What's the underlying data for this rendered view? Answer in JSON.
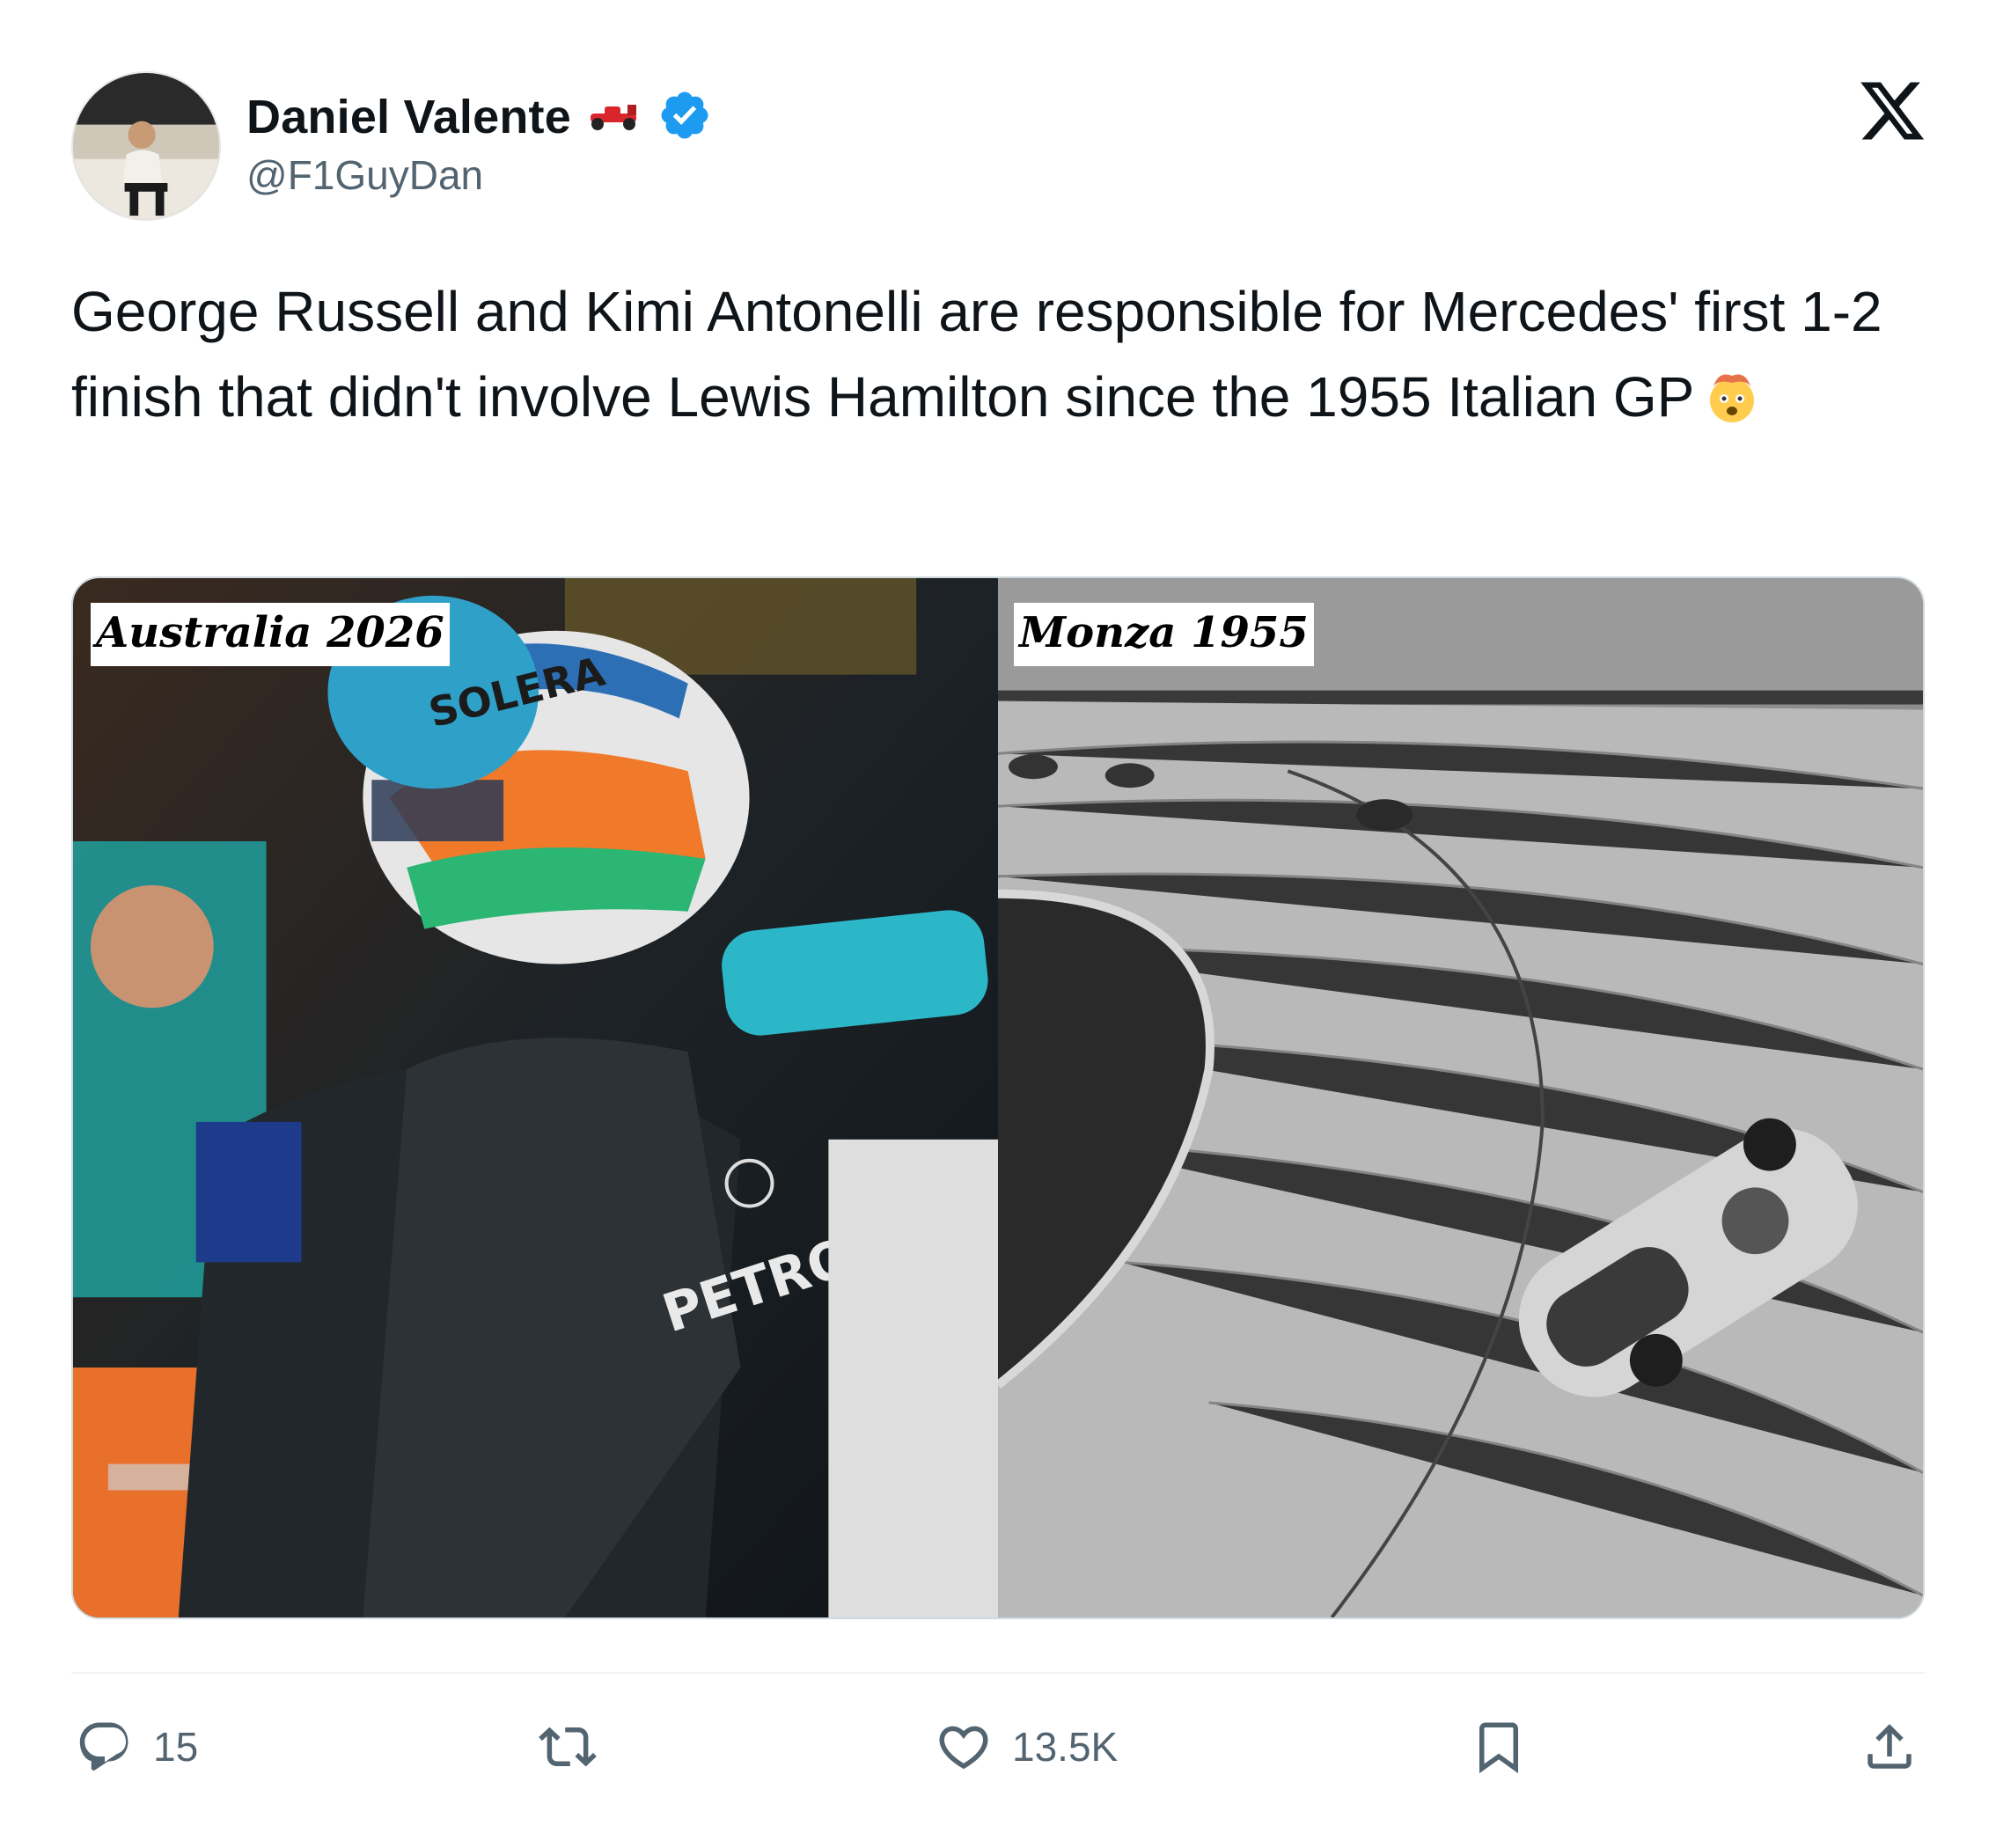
{
  "author": {
    "display_name": "Daniel Valente",
    "handle": "@F1GuyDan",
    "badge_emoji": "race-car-icon",
    "verified": true,
    "verified_color": "#1d9bf0"
  },
  "tweet": {
    "text": "George Russell and Kimi Antonelli are responsible for Mercedes' first 1-2 finish that didn't involve Lewis Hamilton since the 1955 Italian GP",
    "emoji": "exploding-head-icon"
  },
  "media": {
    "left_caption": "Australia 2026",
    "right_caption": "Monza 1955"
  },
  "actions": {
    "replies": "15",
    "retweets": "",
    "likes": "13.5K"
  },
  "colors": {
    "text": "#0f1419",
    "secondary": "#536471",
    "accent": "#1d9bf0"
  }
}
